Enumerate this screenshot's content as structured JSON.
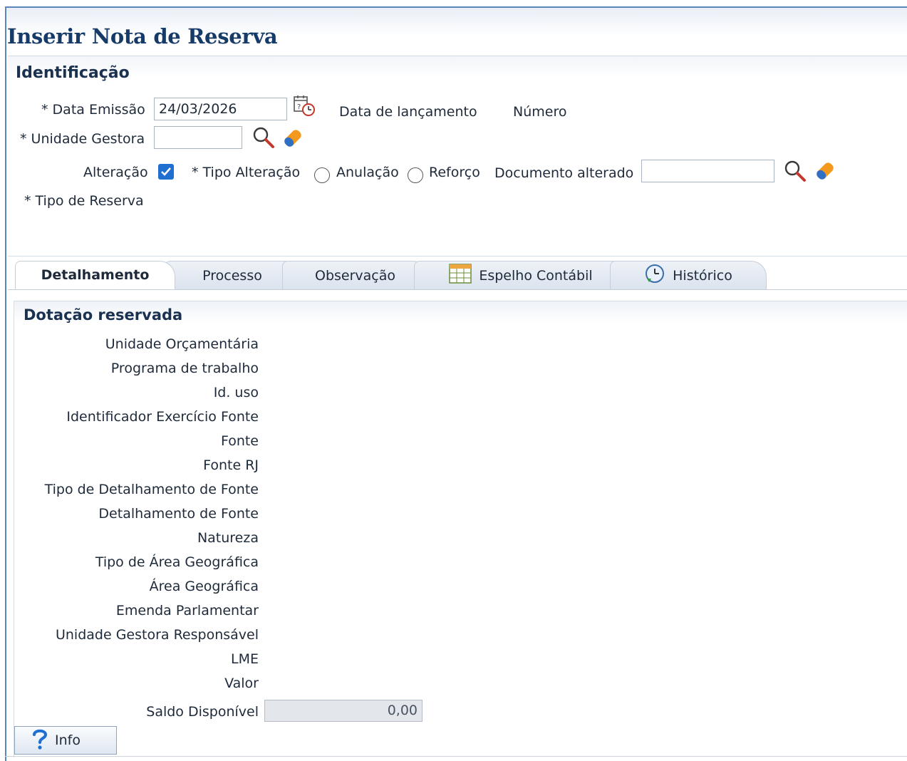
{
  "page": {
    "title": "Inserir Nota de Reserva"
  },
  "identificacao": {
    "title": "Identificação",
    "data_emissao_label": "* Data Emissão",
    "data_emissao_value": "24/03/2026",
    "data_lancamento_label": "Data de lançamento",
    "numero_label": "Número",
    "unidade_gestora_label": "* Unidade Gestora",
    "unidade_gestora_value": "",
    "alteracao_label": "Alteração",
    "alteracao_checked": true,
    "tipo_alteracao_label": "* Tipo Alteração",
    "anulacao_label": "Anulação",
    "reforco_label": "Reforço",
    "documento_alterado_label": "Documento alterado",
    "documento_alterado_value": "",
    "tipo_reserva_label": "* Tipo de Reserva"
  },
  "tabs": [
    {
      "label": "Detalhamento",
      "active": true
    },
    {
      "label": "Processo"
    },
    {
      "label": "Observação"
    },
    {
      "label": "Espelho Contábil",
      "icon": "spreadsheet-icon"
    },
    {
      "label": "Histórico",
      "icon": "history-icon"
    }
  ],
  "dotacao": {
    "title": "Dotação reservada",
    "labels": [
      "Unidade Orçamentária",
      "Programa de trabalho",
      "Id. uso",
      "Identificador Exercício Fonte",
      "Fonte",
      "Fonte RJ",
      "Tipo de Detalhamento de Fonte",
      "Detalhamento de Fonte",
      "Natureza",
      "Tipo de Área Geográfica",
      "Área Geográfica",
      "Emenda Parlamentar",
      "Unidade Gestora Responsável",
      "LME",
      "Valor"
    ],
    "saldo_label": "Saldo Disponível",
    "saldo_value": "0,00"
  },
  "info_button": {
    "label": "Info"
  },
  "colors": {
    "title": "#163b68",
    "accent": "#1f6fd1",
    "eraser": "#f39a1e"
  }
}
